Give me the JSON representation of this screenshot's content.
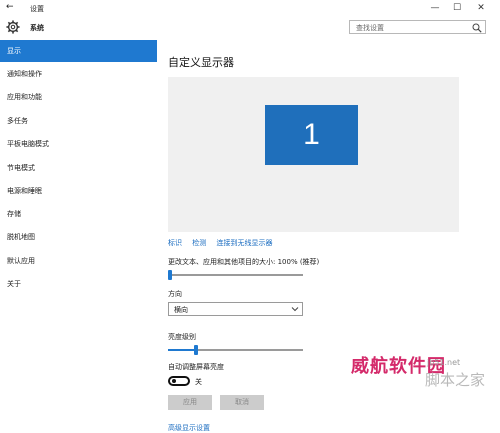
{
  "window": {
    "title": "设置",
    "back_glyph": "←",
    "controls": {
      "minimize": "—",
      "maximize": "☐",
      "close": "✕"
    }
  },
  "header": {
    "brand": "系统",
    "icon": "gear-icon",
    "search": {
      "placeholder": "查找设置",
      "icon": "search-icon"
    }
  },
  "sidebar": {
    "items": [
      {
        "label": "显示",
        "active": true
      },
      {
        "label": "通知和操作"
      },
      {
        "label": "应用和功能"
      },
      {
        "label": "多任务"
      },
      {
        "label": "平板电脑模式"
      },
      {
        "label": "节电模式"
      },
      {
        "label": "电源和睡眠"
      },
      {
        "label": "存储"
      },
      {
        "label": "脱机地图"
      },
      {
        "label": "默认应用"
      },
      {
        "label": "关于"
      }
    ]
  },
  "main": {
    "title": "自定义显示器",
    "monitor_number": "1",
    "links": {
      "identify": "标识",
      "detect": "检测",
      "wireless": "连接到无线显示器"
    },
    "scale": {
      "label": "更改文本、应用和其他项目的大小: 100% (推荐)",
      "level": 0.0
    },
    "orientation": {
      "label": "方向",
      "value": "横向"
    },
    "brightness": {
      "label": "亮度级别",
      "level": 0.2
    },
    "auto_brightness": {
      "label": "自动调整屏幕亮度",
      "state": "关"
    },
    "buttons": {
      "apply": "应用",
      "cancel": "取消"
    },
    "advanced_link": "高级显示设置"
  },
  "watermark": {
    "line1": "威航软件园",
    "line2": "jb51.net",
    "line3": "脚本之家"
  },
  "colors": {
    "accent": "#1f79d0",
    "monitor": "#1f6fbb",
    "link": "#1a6cc0",
    "disabled_button": "#cccccc"
  }
}
